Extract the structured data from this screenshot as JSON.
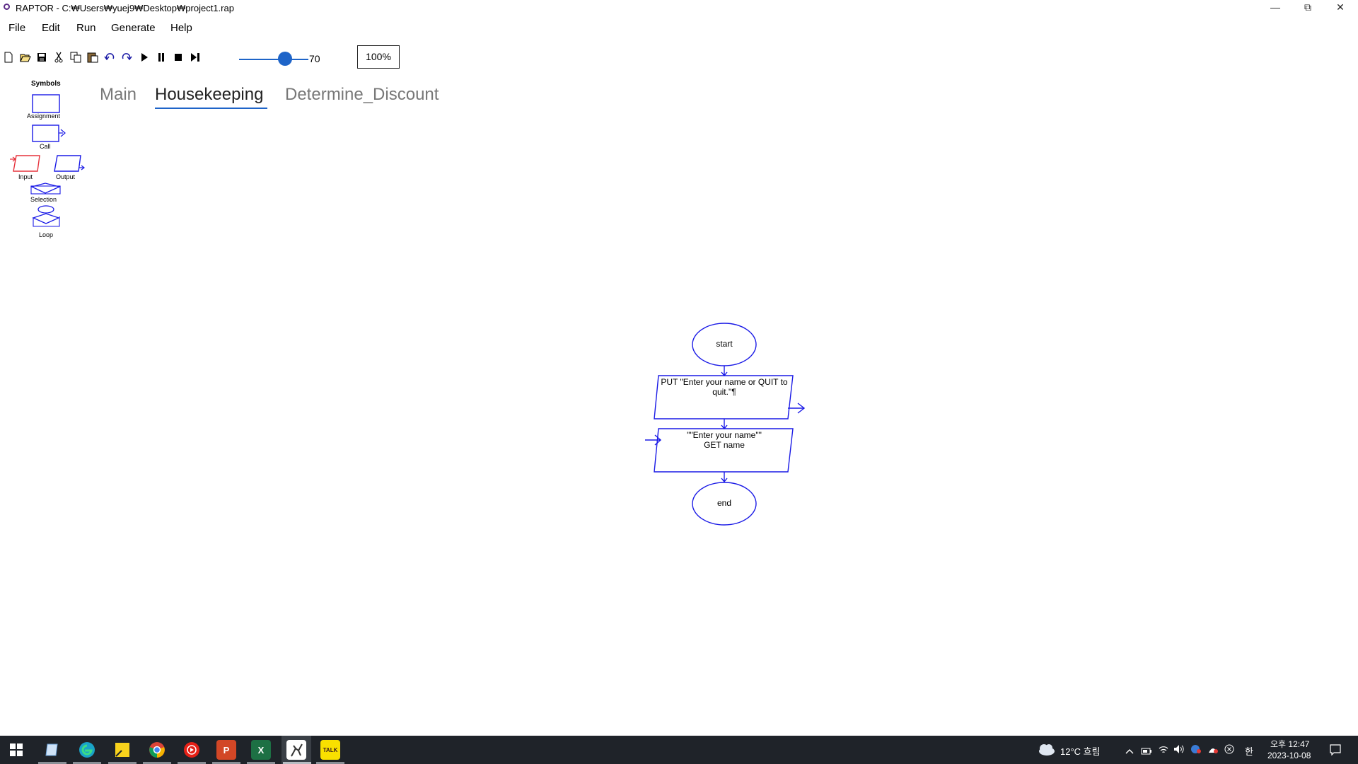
{
  "window": {
    "title": "RAPTOR - C:₩Users₩yuej9₩Desktop₩project1.rap",
    "minimize_glyph": "—",
    "restore_glyph": "⧉",
    "close_glyph": "✕"
  },
  "menu": {
    "items": [
      "File",
      "Edit",
      "Run",
      "Generate",
      "Help"
    ]
  },
  "toolbar": {
    "buttons": [
      "new-file-icon",
      "open-file-icon",
      "save-icon",
      "cut-icon",
      "copy-icon",
      "paste-icon",
      "undo-icon",
      "redo-icon",
      "play-icon",
      "pause-icon",
      "stop-icon",
      "step-icon"
    ],
    "speed_value": "70",
    "speed_fraction": 0.7,
    "zoom": "100%"
  },
  "symbols": {
    "title": "Symbols",
    "assignment": "Assignment",
    "call": "Call",
    "input": "Input",
    "output": "Output",
    "selection": "Selection",
    "loop": "Loop"
  },
  "tabs": {
    "items": [
      "Main",
      "Housekeeping",
      "Determine_Discount"
    ],
    "active": "Housekeeping"
  },
  "flowchart": {
    "start": "start",
    "output_line1": "PUT \"Enter your name or QUIT to",
    "output_line2": "quit.\"¶",
    "input_line1": "\"\"Enter your name\"\"",
    "input_line2": "GET name",
    "end": "end",
    "stroke_color": "#1a1ae6"
  },
  "taskbar": {
    "apps": [
      "windows-start-icon",
      "file-explorer-icon",
      "edge-icon",
      "sticky-notes-icon",
      "chrome-icon",
      "youtube-music-icon",
      "powerpoint-icon",
      "excel-icon",
      "raptor-icon",
      "kakaotalk-icon"
    ],
    "powerpoint_letter": "P",
    "excel_letter": "X",
    "kakaotalk_label": "TALK",
    "weather": "12°C 흐림",
    "ime": "한",
    "time": "오후 12:47",
    "date": "2023-10-08"
  }
}
